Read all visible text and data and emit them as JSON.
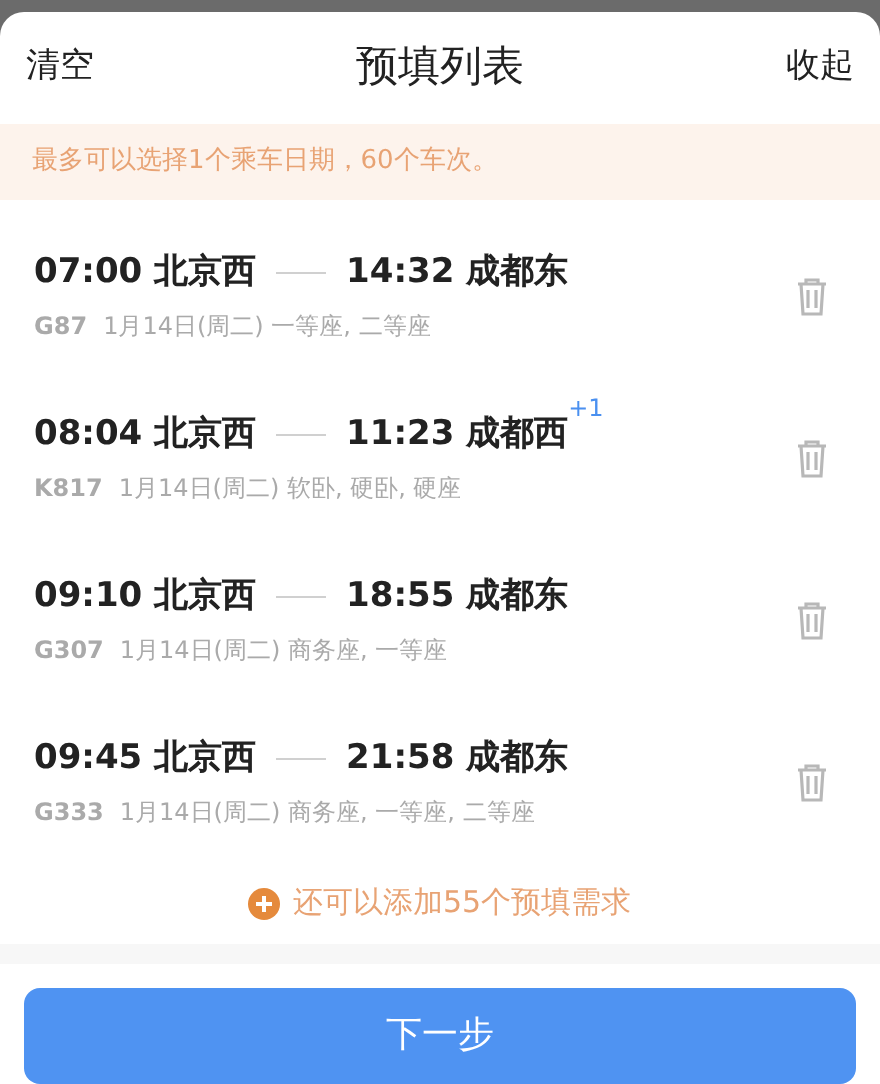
{
  "header": {
    "left": "清空",
    "title": "预填列表",
    "right": "收起"
  },
  "notice": "最多可以选择1个乘车日期，60个车次。",
  "trains": [
    {
      "depart_time": "07:00",
      "depart_station": "北京西",
      "arrive_time": "14:32",
      "arrive_station": "成都东",
      "train_no": "G87",
      "date": "1月14日(周二)",
      "seats": "一等座, 二等座"
    },
    {
      "depart_time": "08:04",
      "depart_station": "北京西",
      "arrive_time": "11:23",
      "arrive_station": "成都西",
      "day_offset": "+1",
      "train_no": "K817",
      "date": "1月14日(周二)",
      "seats": "软卧, 硬卧, 硬座"
    },
    {
      "depart_time": "09:10",
      "depart_station": "北京西",
      "arrive_time": "18:55",
      "arrive_station": "成都东",
      "train_no": "G307",
      "date": "1月14日(周二)",
      "seats": "商务座, 一等座"
    },
    {
      "depart_time": "09:45",
      "depart_station": "北京西",
      "arrive_time": "21:58",
      "arrive_station": "成都东",
      "train_no": "G333",
      "date": "1月14日(周二)",
      "seats": "商务座, 一等座, 二等座"
    }
  ],
  "add_more": "还可以添加55个预填需求",
  "next_button": "下一步"
}
